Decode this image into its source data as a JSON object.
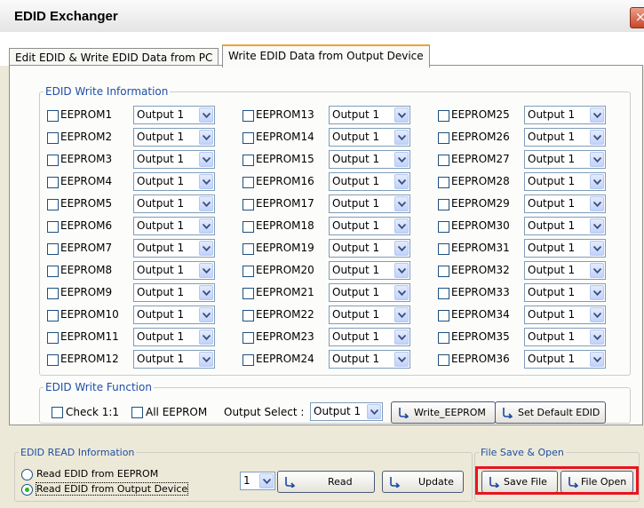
{
  "window": {
    "title": "EDID Exchanger",
    "close_glyph": "×"
  },
  "tabs": [
    {
      "label": "Edit EDID & Write EDID Data from PC"
    },
    {
      "label": "Write EDID Data from Output Device"
    }
  ],
  "write_info": {
    "legend": "EDID Write Information",
    "eeproms": [
      {
        "label": "EEPROM1",
        "output": "Output 1"
      },
      {
        "label": "EEPROM2",
        "output": "Output 1"
      },
      {
        "label": "EEPROM3",
        "output": "Output 1"
      },
      {
        "label": "EEPROM4",
        "output": "Output 1"
      },
      {
        "label": "EEPROM5",
        "output": "Output 1"
      },
      {
        "label": "EEPROM6",
        "output": "Output 1"
      },
      {
        "label": "EEPROM7",
        "output": "Output 1"
      },
      {
        "label": "EEPROM8",
        "output": "Output 1"
      },
      {
        "label": "EEPROM9",
        "output": "Output 1"
      },
      {
        "label": "EEPROM10",
        "output": "Output 1"
      },
      {
        "label": "EEPROM11",
        "output": "Output 1"
      },
      {
        "label": "EEPROM12",
        "output": "Output 1"
      },
      {
        "label": "EEPROM13",
        "output": "Output 1"
      },
      {
        "label": "EEPROM14",
        "output": "Output 1"
      },
      {
        "label": "EEPROM15",
        "output": "Output 1"
      },
      {
        "label": "EEPROM16",
        "output": "Output 1"
      },
      {
        "label": "EEPROM17",
        "output": "Output 1"
      },
      {
        "label": "EEPROM18",
        "output": "Output 1"
      },
      {
        "label": "EEPROM19",
        "output": "Output 1"
      },
      {
        "label": "EEPROM20",
        "output": "Output 1"
      },
      {
        "label": "EEPROM21",
        "output": "Output 1"
      },
      {
        "label": "EEPROM22",
        "output": "Output 1"
      },
      {
        "label": "EEPROM23",
        "output": "Output 1"
      },
      {
        "label": "EEPROM24",
        "output": "Output 1"
      },
      {
        "label": "EEPROM25",
        "output": "Output 1"
      },
      {
        "label": "EEPROM26",
        "output": "Output 1"
      },
      {
        "label": "EEPROM27",
        "output": "Output 1"
      },
      {
        "label": "EEPROM28",
        "output": "Output 1"
      },
      {
        "label": "EEPROM29",
        "output": "Output 1"
      },
      {
        "label": "EEPROM30",
        "output": "Output 1"
      },
      {
        "label": "EEPROM31",
        "output": "Output 1"
      },
      {
        "label": "EEPROM32",
        "output": "Output 1"
      },
      {
        "label": "EEPROM33",
        "output": "Output 1"
      },
      {
        "label": "EEPROM34",
        "output": "Output 1"
      },
      {
        "label": "EEPROM35",
        "output": "Output 1"
      },
      {
        "label": "EEPROM36",
        "output": "Output 1"
      }
    ]
  },
  "write_function": {
    "legend": "EDID Write Function",
    "check_1to1": "Check 1:1",
    "all_eeprom": "All EEPROM",
    "output_select_label": "Output Select :",
    "output_select_value": "Output 1",
    "write_button": "Write_EEPROM",
    "default_button": "Set Default EDID"
  },
  "read_info": {
    "legend": "EDID READ Information",
    "radio_eeprom": "Read EDID from EEPROM",
    "radio_output": "Read EDID from Output Device",
    "number_value": "1",
    "read_button": "Read",
    "update_button": "Update"
  },
  "file_section": {
    "legend": "File Save & Open",
    "save_button": "Save File",
    "open_button": "File Open"
  },
  "icons": {
    "dropdown": "chevron-down-icon",
    "action": "arrow-action-icon",
    "close": "close-icon"
  },
  "colors": {
    "legend_text": "#1f4fa3",
    "highlight": "#e8141e",
    "tab_accent": "#e9a53d"
  }
}
